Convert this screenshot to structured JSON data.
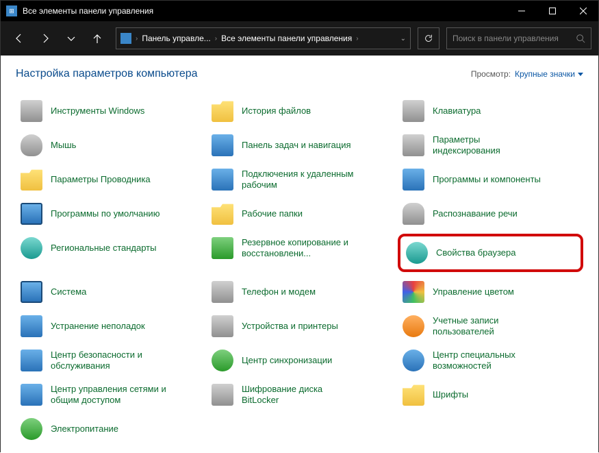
{
  "window": {
    "title": "Все элементы панели управления"
  },
  "breadcrumb": {
    "root": "Панель управле...",
    "current": "Все элементы панели управления"
  },
  "search": {
    "placeholder": "Поиск в панели управления"
  },
  "page": {
    "title": "Настройка параметров компьютера",
    "view_label": "Просмотр:",
    "view_value": "Крупные значки"
  },
  "items": {
    "c0r0": "Инструменты Windows",
    "c1r0": "История файлов",
    "c2r0": "Клавиатура",
    "c0r1": "Мышь",
    "c1r1": "Панель задач и навигация",
    "c2r1": "Параметры индексирования",
    "c0r2": "Параметры Проводника",
    "c1r2": "Подключения к удаленным рабочим",
    "c2r2": "Программы и компоненты",
    "c0r3": "Программы по умолчанию",
    "c1r3": "Рабочие папки",
    "c2r3": "Распознавание речи",
    "c0r4": "Региональные стандарты",
    "c1r4": "Резервное копирование и восстановлени...",
    "c2r4": "Свойства браузера",
    "c0r5": "Система",
    "c1r5": "Телефон и модем",
    "c2r5": "Управление цветом",
    "c0r6": "Устранение неполадок",
    "c1r6": "Устройства и принтеры",
    "c2r6": "Учетные записи пользователей",
    "c0r7": "Центр безопасности и обслуживания",
    "c1r7": "Центр синхронизации",
    "c2r7": "Центр специальных возможностей",
    "c0r8": "Центр управления сетями и общим доступом",
    "c1r8": "Шифрование диска BitLocker",
    "c2r8": "Шрифты",
    "c0r9": "Электропитание"
  }
}
